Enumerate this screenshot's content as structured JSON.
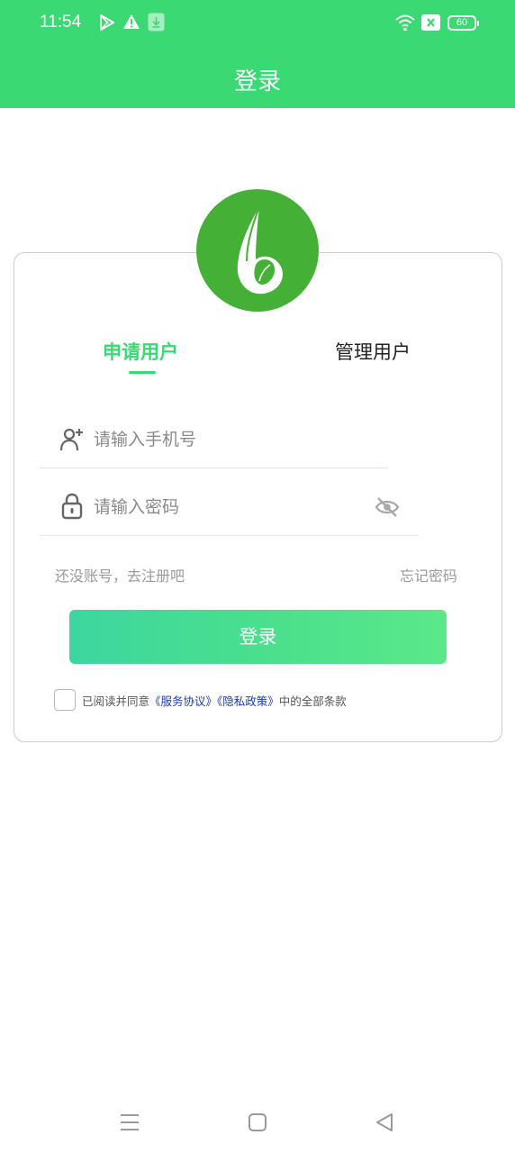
{
  "status_bar": {
    "time": "11:54",
    "battery": "60",
    "icons": [
      "play-store-icon",
      "warning-icon",
      "download-icon",
      "wifi-icon",
      "close-box-icon",
      "battery-icon"
    ]
  },
  "app_bar": {
    "title": "登录"
  },
  "tabs": [
    {
      "label": "申请用户",
      "selected": true
    },
    {
      "label": "管理用户",
      "selected": false
    }
  ],
  "form": {
    "phone": {
      "placeholder": "请输入手机号",
      "value": ""
    },
    "password": {
      "placeholder": "请输入密码",
      "value": ""
    }
  },
  "links": {
    "register": "还没账号，去注册吧",
    "forgot": "忘记密码"
  },
  "login_button": "登录",
  "agreement": {
    "checked": false,
    "prefix": "已阅读并同意",
    "service": "《服务协议》",
    "privacy": "《隐私政策》",
    "suffix": "中的全部条款"
  },
  "colors": {
    "brand_green": "#3ad973",
    "logo_green": "#45b036",
    "link_blue": "#1a3cb0"
  },
  "nav_bar": [
    "menu-icon",
    "home-icon",
    "back-icon"
  ]
}
